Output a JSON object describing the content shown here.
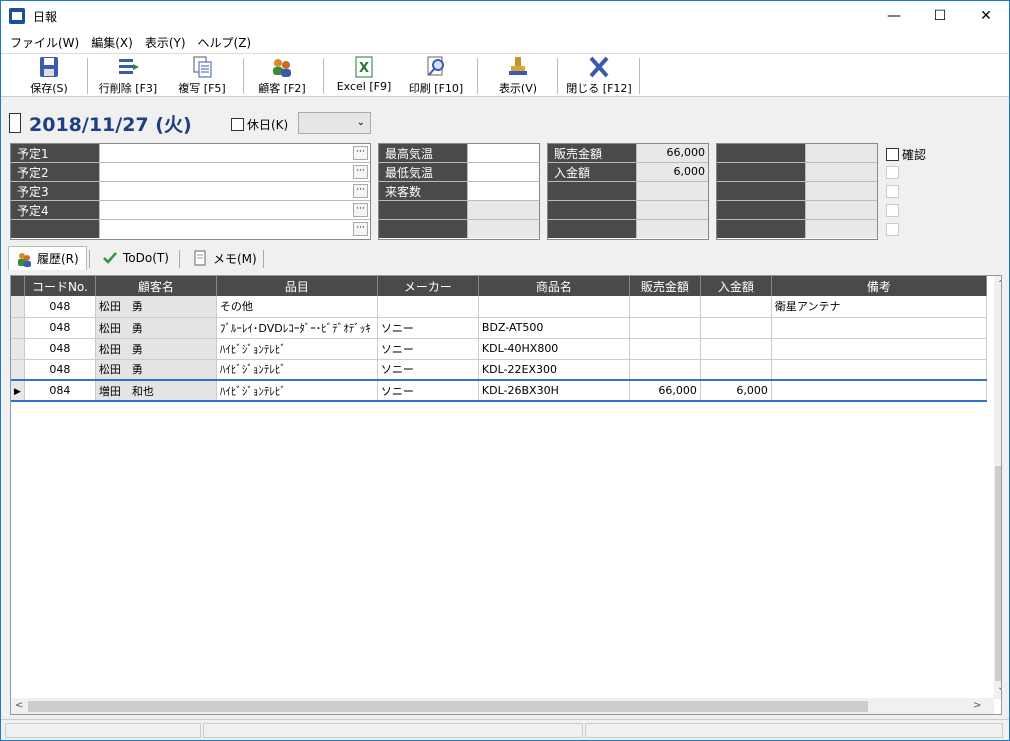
{
  "window": {
    "title": "日報"
  },
  "menu": [
    "ファイル(W)",
    "編集(X)",
    "表示(Y)",
    "ヘルプ(Z)"
  ],
  "toolbar": {
    "save": "保存(S)",
    "delete_row": "行削除 [F3]",
    "copy": "複写 [F5]",
    "customer": "顧客 [F2]",
    "excel": "Excel [F9]",
    "print": "印刷 [F10]",
    "display": "表示(V)",
    "close": "閉じる [F12]"
  },
  "date": "2018/11/27 (火)",
  "holiday_label": "休日(K)",
  "schedule": [
    "予定1",
    "予定2",
    "予定3",
    "予定4",
    ""
  ],
  "weather": [
    {
      "label": "最高気温",
      "value": ""
    },
    {
      "label": "最低気温",
      "value": ""
    },
    {
      "label": "来客数",
      "value": ""
    }
  ],
  "sales": [
    {
      "label": "販売金額",
      "value": "66,000"
    },
    {
      "label": "入金額",
      "value": "6,000"
    }
  ],
  "confirm_label": "確認",
  "tabs": [
    "履歴(R)",
    "ToDo(T)",
    "メモ(M)"
  ],
  "table": {
    "headers": [
      "コードNo.",
      "顧客名",
      "品目",
      "メーカー",
      "商品名",
      "販売金額",
      "入金額",
      "備考"
    ],
    "rows": [
      [
        "048",
        "松田　勇",
        "その他",
        "",
        "",
        "",
        "",
        "衛星アンテナ"
      ],
      [
        "048",
        "松田　勇",
        "ﾌﾞﾙｰﾚｲ･DVDﾚｺｰﾀﾞｰ･ﾋﾞﾃﾞｵﾃﾞｯｷ",
        "ソニー",
        "BDZ-AT500",
        "",
        "",
        ""
      ],
      [
        "048",
        "松田　勇",
        "ﾊｲﾋﾞｼﾞｮﾝﾃﾚﾋﾞ",
        "ソニー",
        "KDL-40HX800",
        "",
        "",
        ""
      ],
      [
        "048",
        "松田　勇",
        "ﾊｲﾋﾞｼﾞｮﾝﾃﾚﾋﾞ",
        "ソニー",
        "KDL-22EX300",
        "",
        "",
        ""
      ],
      [
        "084",
        "増田　和也",
        "ﾊｲﾋﾞｼﾞｮﾝﾃﾚﾋﾞ",
        "ソニー",
        "KDL-26BX30H",
        "66,000",
        "6,000",
        ""
      ]
    ],
    "current_row": 4
  }
}
